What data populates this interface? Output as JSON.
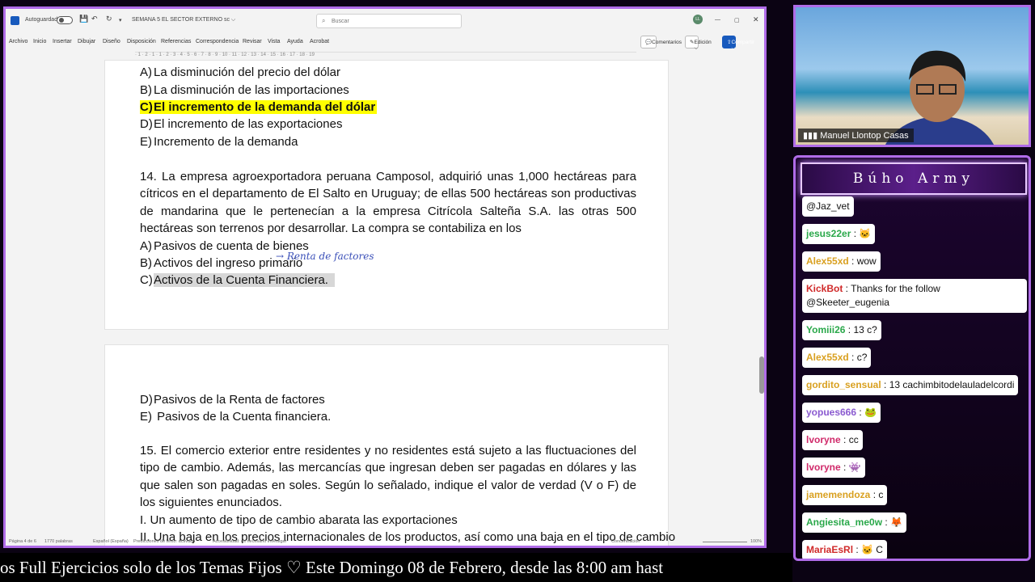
{
  "word": {
    "autosave": "Autoguardado",
    "doc_title": "SEMANA 5 EL SECTOR EXTERNO sc ⌵",
    "search_placeholder": "Buscar",
    "avatar": "LL",
    "menu": [
      "Archivo",
      "Inicio",
      "Insertar",
      "Dibujar",
      "Diseño",
      "Disposición",
      "Referencias",
      "Correspondencia",
      "Revisar",
      "Vista",
      "Ayuda",
      "Acrobat"
    ],
    "comments": "Comentarios",
    "editing": "Edición ⌵",
    "share": "Compartir ⌵",
    "ruler": "· 1 · 2 · 1 · 1 · 2 · 3 · 4 · 5 · 6 · 7 · 8 · 9 · 10 · 11 · 12 · 13 · 14 · 15 · 16 · 17 · 18 · 19",
    "page1": {
      "options_prev": [
        {
          "letter": "A)",
          "text": "La disminución del precio del dólar"
        },
        {
          "letter": "B)",
          "text": "La disminución de las importaciones"
        },
        {
          "letter": "C)",
          "text": "El incremento de la demanda del dólar"
        },
        {
          "letter": "D)",
          "text": "El incremento de las exportaciones"
        },
        {
          "letter": "E)",
          "text": "Incremento de la demanda"
        }
      ],
      "q14": "14. La empresa agroexportadora peruana Camposol, adquirió unas 1,000 hectáreas para cítricos en el departamento de El Salto en Uruguay; de ellas 500 hectáreas son productivas de mandarina que le pertenecían a la empresa Citrícola Salteña S.A. las otras 500 hectáreas son terrenos por desarrollar. La compra se contabiliza en los",
      "q14_options": [
        {
          "letter": "A)",
          "text": "Pasivos de cuenta de bienes"
        },
        {
          "letter": "B)",
          "text": "Activos del ingreso primario"
        },
        {
          "letter": "C)",
          "text": "Activos de la Cuenta Financiera."
        }
      ],
      "handwritten": "→ Renta de factores"
    },
    "page2": {
      "options": [
        {
          "letter": "D)",
          "text": "Pasivos de la Renta de factores"
        },
        {
          "letter": "E)",
          "text": " Pasivos de la Cuenta financiera."
        }
      ],
      "q15": "15. El comercio exterior entre residentes y no residentes está sujeto a las fluctuaciones del tipo de cambio. Además, las mercancías que ingresan deben ser pagadas en dólares y las que salen son pagadas en soles. Según lo señalado, indique el valor de verdad (V o F) de los siguientes enunciados.",
      "item1": "I.  Un aumento de tipo de cambio abarata las exportaciones",
      "item2": "II. Una baja en los precios internacionales de los productos, así como una baja en el tipo de cambio"
    },
    "status": {
      "page": "Página 4 de 6",
      "words": "1770 palabras",
      "lang": "Español (España)",
      "predictions": "Predicciones de texto: activado",
      "access": "Accesibilidad: es necesario investigar",
      "focus": "Concentración",
      "zoom": "100%"
    }
  },
  "camera": {
    "name": "Manuel Llontop Casas"
  },
  "chat": {
    "title": "Búho Army",
    "messages": [
      {
        "user": "",
        "text": "@Jaz_vet",
        "color": "#111111"
      },
      {
        "user": "jesus22er",
        "text": " : 🐱",
        "color": "#2aa84a"
      },
      {
        "user": "Alex55xd",
        "text": " : wow",
        "color": "#d9a020"
      },
      {
        "user": "KickBot",
        "text": " : Thanks for the follow @Skeeter_eugenia",
        "color": "#d02a2a"
      },
      {
        "user": "Yomiii26",
        "text": " : 13 c?",
        "color": "#2aa84a"
      },
      {
        "user": "Alex55xd",
        "text": " : c?",
        "color": "#d9a020"
      },
      {
        "user": "gordito_sensual",
        "text": " : 13 cachimbitodelauladelcordi",
        "color": "#d9a020"
      },
      {
        "user": "yopues666",
        "text": " : 🐸",
        "color": "#8a5ad0"
      },
      {
        "user": "lvoryne",
        "text": " : cc",
        "color": "#d02a6a"
      },
      {
        "user": "lvoryne",
        "text": " : 👾",
        "color": "#d02a6a"
      },
      {
        "user": "jamemendoza",
        "text": " : c",
        "color": "#d9a020"
      },
      {
        "user": "Angiesita_me0w",
        "text": " : 🦊",
        "color": "#2aa84a"
      },
      {
        "user": "MariaEsRl",
        "text": " : 🐱 C",
        "color": "#d02a2a"
      },
      {
        "user": "Yomiii26",
        "text": " : C",
        "color": "#2aa84a"
      }
    ]
  },
  "ticker": "os Full Ejercicios solo de los Temas Fijos ♡  Este Domingo 08 de Febrero, desde las 8:00 am hast"
}
